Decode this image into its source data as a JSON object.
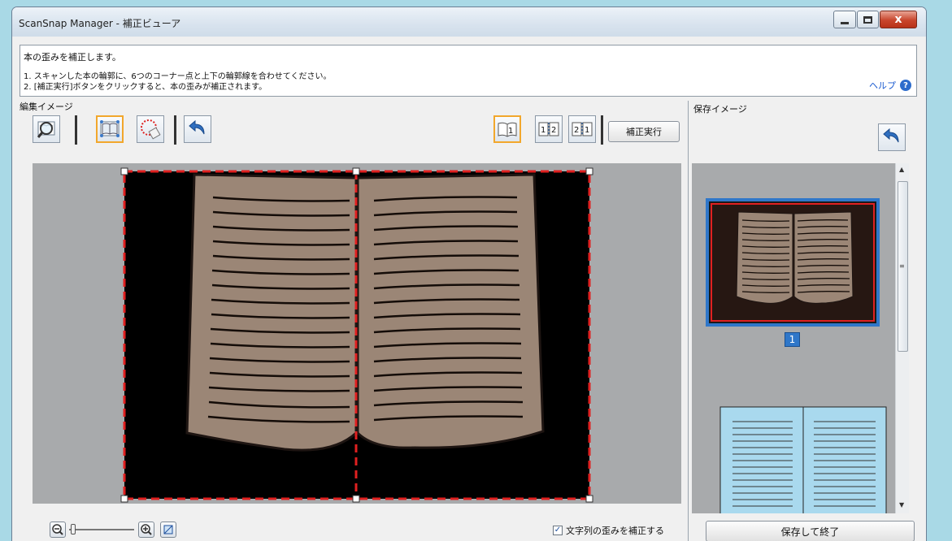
{
  "window": {
    "title": "ScanSnap Manager - 補正ビューア",
    "controls": {
      "minimize": "minimize",
      "maximize": "maximize",
      "close": "x"
    }
  },
  "instructions": {
    "heading": "本の歪みを補正します。",
    "step1": "1. スキャンした本の輪郭に、6つのコーナー点と上下の輪郭線を合わせてください。",
    "step2": "2. [補正実行]ボタンをクリックすると、本の歪みが補正されます。",
    "help_label": "ヘルプ",
    "help_icon": "?"
  },
  "edit_panel": {
    "label": "編集イメージ",
    "toolbar": {
      "tools": [
        {
          "name": "magnifier-tool",
          "icon": "magnifier-icon",
          "selected": false
        },
        {
          "name": "book-tool",
          "icon": "book-icon",
          "selected": true
        },
        {
          "name": "select-tool",
          "icon": "dotted-select-icon",
          "selected": false
        },
        {
          "name": "undo-tool",
          "icon": "undo-icon",
          "selected": false
        }
      ],
      "page_modes": [
        {
          "name": "single-page",
          "label": "1",
          "selected": true
        },
        {
          "name": "two-page-lr",
          "label": "1 2",
          "selected": false
        },
        {
          "name": "two-page-rl",
          "label": "2 1",
          "selected": false
        }
      ],
      "execute_label": "補正実行"
    }
  },
  "save_panel": {
    "label": "保存イメージ",
    "rotate_icon": "rotate-icon",
    "pages": [
      {
        "number": "1",
        "selected": true
      }
    ]
  },
  "bottom": {
    "checkbox_label": "文字列の歪みを補正する",
    "checkbox_checked": true,
    "checkbox_mark": "✓",
    "save_label": "保存して終了",
    "zoom_slider_value": 0.05
  },
  "colors": {
    "selection_highlight": "#f2a72c",
    "outline_dash": "#e02020",
    "page_color": "#9b8676",
    "page_badge": "#2f77c9"
  }
}
